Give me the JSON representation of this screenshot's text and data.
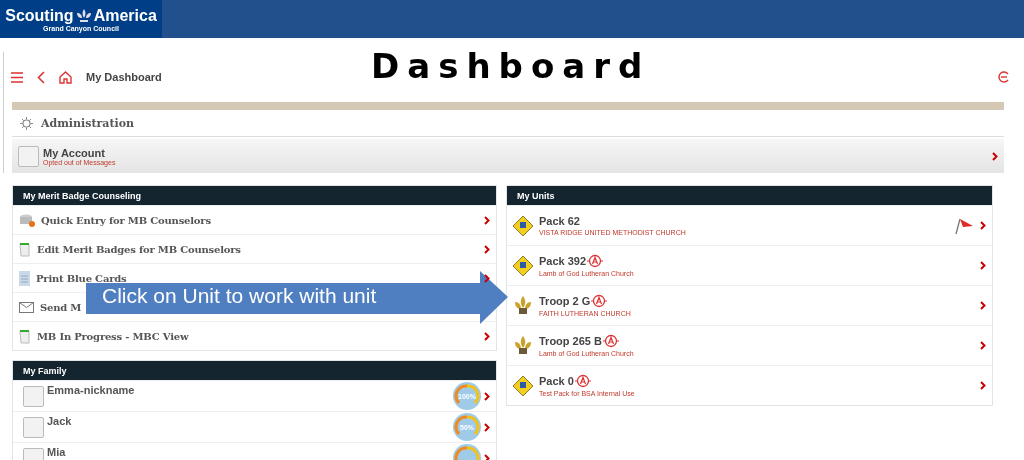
{
  "header": {
    "logo_title": "Scouting",
    "logo_title_2": "America",
    "logo_subtitle": "Grand Canyon Council"
  },
  "nav": {
    "breadcrumb": "My Dashboard",
    "page_title": "Dashboard"
  },
  "administration": {
    "title": "Administration",
    "account": {
      "name": "My Account",
      "note": "Opted out of Messages"
    }
  },
  "merit_badge_counseling": {
    "title": "My Merit Badge Counseling",
    "items": [
      {
        "label": "Quick Entry for MB Counselors",
        "kind": "entry",
        "chevron": true
      },
      {
        "label": "Edit Merit Badges for MB Counselors",
        "kind": "book",
        "chevron": true
      },
      {
        "label": "Print Blue Cards",
        "kind": "card",
        "chevron": true
      },
      {
        "label": "Send M",
        "kind": "mail",
        "chevron": false
      },
      {
        "label": "MB In Progress - MBC View",
        "kind": "book",
        "chevron": true
      }
    ]
  },
  "family": {
    "title": "My Family",
    "members": [
      {
        "name": "Emma-nickname",
        "progress": "100%"
      },
      {
        "name": "Jack",
        "progress": "50%"
      },
      {
        "name": "Mia"
      }
    ]
  },
  "units": {
    "title": "My Units",
    "items": [
      {
        "name": "Pack 62",
        "org": "VISTA RIDGE UNITED METHODIST CHURCH",
        "kind": "pack",
        "flagged": true,
        "advancement": false
      },
      {
        "name": "Pack 392",
        "org": "Lamb of God Lutheran Church",
        "kind": "pack",
        "flagged": false,
        "advancement": true
      },
      {
        "name": "Troop 2 G",
        "org": "FAITH LUTHERAN CHURCH",
        "kind": "troop",
        "flagged": false,
        "advancement": true
      },
      {
        "name": "Troop 265 B",
        "org": "Lamb of God Lutheran Church",
        "kind": "troop",
        "flagged": false,
        "advancement": true
      },
      {
        "name": "Pack 0",
        "org": "Test Pack for BSA Internal Use",
        "kind": "pack",
        "flagged": false,
        "advancement": true
      }
    ]
  },
  "callout": {
    "text": "Click on Unit to work with unit"
  }
}
